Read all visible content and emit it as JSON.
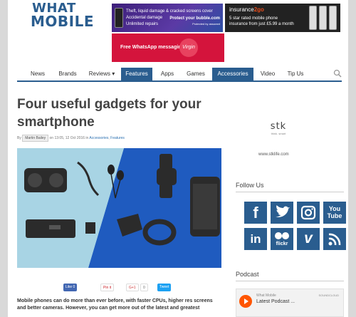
{
  "logo": {
    "line1": "WHAT",
    "line2": "MOBILE"
  },
  "ads": {
    "ad1": {
      "lines": [
        "Theft, liquid damage & cracked screens cover",
        "Accidental damage",
        "Unlimited repairs"
      ],
      "cta": "Protect your bubble.com",
      "sub": "Protected by assurant"
    },
    "ad2": {
      "brand_prefix": "insurance",
      "brand_suffix": "2go",
      "line1": "5 star rated mobile phone",
      "line2": "insurance from just £5.99 a month"
    },
    "ad3": {
      "text": "Free WhatsApp messaging",
      "logo": "Virgin"
    }
  },
  "nav": {
    "items": [
      "News",
      "Brands",
      "Reviews ▾",
      "Features",
      "Apps",
      "Games",
      "Accessories",
      "Video",
      "Tip Us"
    ],
    "active": [
      "Features",
      "Accessories"
    ]
  },
  "article": {
    "title": "Four useful gadgets for your smartphone",
    "by": "By",
    "author": "Martin Bailey",
    "on": "on 13:05, 12 Oct 2016 in",
    "cat1": "Accessories",
    "sep": ",",
    "cat2": "Features",
    "excerpt": "Mobile phones can do more than ever before, with faster CPUs, higher res screens and better cameras. However, you can get more out of the latest and greatest"
  },
  "share": {
    "like": "Like 0",
    "pin": "Pin it",
    "gplus": "G+1",
    "gplus_count": "0",
    "tweet": "Tweet"
  },
  "sidebar": {
    "stk_mark": "stk",
    "stk_tag": "think. smart",
    "stk_url": "www.stklife.com",
    "follow_title": "Follow Us",
    "social": [
      "f",
      "t",
      "ig",
      "You Tube",
      "in",
      "flickr",
      "v",
      "rss"
    ],
    "podcast_title": "Podcast",
    "player": {
      "who": "What Mobile",
      "what": "Latest Podcast ...",
      "sc": "SOUNDCLOUD"
    }
  },
  "colors": {
    "brand": "#2a5d8f",
    "accent_orange": "#f50",
    "ad_red": "#d4143c"
  }
}
